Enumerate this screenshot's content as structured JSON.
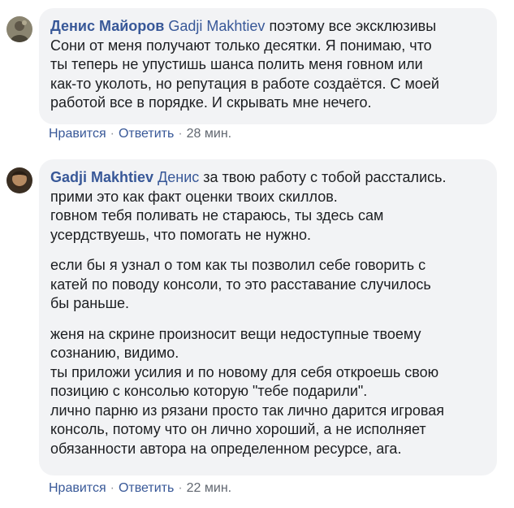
{
  "comments": [
    {
      "author": "Денис Майоров",
      "mention": "Gadji Makhtiev",
      "lines": [
        "поэтому все эксклюзивы",
        "Сони от меня получают только десятки. Я понимаю, что",
        "ты теперь не упустишь шанса полить меня говном или",
        "как-то уколоть, но репутация в работе создаётся. С моей",
        "работой все в порядке. И скрывать мне нечего."
      ],
      "like": "Нравится",
      "reply": "Ответить",
      "time": "28 мин."
    },
    {
      "author": "Gadji Makhtiev",
      "mention": "Денис",
      "first_line": "за твою работу с тобой расстались.",
      "para1": [
        "прими это как факт оценки твоих скиллов.",
        "говном тебя поливать не стараюсь, ты здесь сам",
        "усердствуешь, что помогать не нужно."
      ],
      "para2": [
        "если бы я узнал о том как ты позволил себе говорить с",
        "катей по поводу консоли, то это расставание случилось",
        "бы раньше."
      ],
      "para3": [
        "женя на скрине произносит вещи недоступные твоему",
        "сознанию, видимо.",
        "ты приложи усилия и по новому для себя откроешь свою",
        "позицию с консолью которую \"тебе подарили\".",
        "лично парню из рязани просто так лично дарится игровая",
        "консоль, потому что он лично хороший, а не исполняет",
        "обязанности автора на определенном ресурсе, ага."
      ],
      "like": "Нравится",
      "reply": "Ответить",
      "time": "22 мин."
    }
  ],
  "colors": {
    "link": "#385898",
    "bubble": "#f2f3f5",
    "meta": "#616770"
  }
}
